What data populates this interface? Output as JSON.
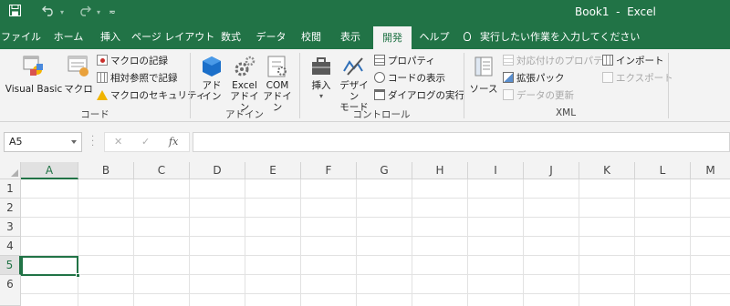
{
  "titlebar": {
    "save_icon": "save-icon",
    "undo_icon": "undo-icon",
    "redo_icon": "redo-icon",
    "customize_icon": "qat-dropdown-icon",
    "doc_title": "Book1  -  Excel"
  },
  "tabs": [
    {
      "label": "ファイル"
    },
    {
      "label": "ホーム"
    },
    {
      "label": "挿入"
    },
    {
      "label": "ページ レイアウト"
    },
    {
      "label": "数式"
    },
    {
      "label": "データ"
    },
    {
      "label": "校閲"
    },
    {
      "label": "表示"
    },
    {
      "label": "開発",
      "active": true
    },
    {
      "label": "ヘルプ"
    }
  ],
  "tellme": "実行したい作業を入力してください",
  "ribbon": {
    "code": {
      "label": "コード",
      "visual_basic": "Visual Basic",
      "macros": "マクロ",
      "record_macro": "マクロの記録",
      "relative_ref": "相対参照で記録",
      "macro_security": "マクロのセキュリティ"
    },
    "addins": {
      "label": "アドイン",
      "addin_1": "アド",
      "addin_2": "イン",
      "excel_addin_1": "Excel",
      "excel_addin_2": "アドイン",
      "com_addin_1": "COM",
      "com_addin_2": "アドイン"
    },
    "controls": {
      "label": "コントロール",
      "insert": "挿入",
      "design_1": "デザイン",
      "design_2": "モード",
      "properties": "プロパティ",
      "view_code": "コードの表示",
      "run_dialog": "ダイアログの実行"
    },
    "xml": {
      "label": "XML",
      "source": "ソース",
      "map_properties": "対応付けのプロパティ",
      "expansion_packs": "拡張パック",
      "refresh_data": "データの更新",
      "import": "インポート",
      "export": "エクスポート"
    }
  },
  "formula_bar": {
    "name_box": "A5",
    "cancel": "✕",
    "enter": "✓",
    "fx": "fx",
    "value": ""
  },
  "sheet": {
    "columns": [
      "A",
      "B",
      "C",
      "D",
      "E",
      "F",
      "G",
      "H",
      "I",
      "J",
      "K",
      "L",
      "M"
    ],
    "rows": [
      "1",
      "2",
      "3",
      "4",
      "5",
      "6"
    ],
    "selected_cell": "A5"
  },
  "colors": {
    "accent": "#217346"
  }
}
